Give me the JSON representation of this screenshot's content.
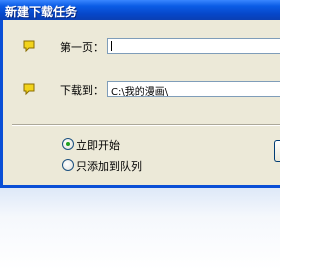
{
  "window": {
    "title": "新建下载任务"
  },
  "form": {
    "page": {
      "label": "第一页：",
      "value": ""
    },
    "save_to": {
      "label": "下载到：",
      "value": "C:\\我的漫画\\"
    }
  },
  "options": [
    {
      "label": "立即开始",
      "selected": true
    },
    {
      "label": "只添加到队列",
      "selected": false
    }
  ],
  "colors": {
    "titlebar": "#0b5ce6",
    "dialog_bg": "#ece9d8",
    "field_border": "#7f9db9",
    "note_icon": "#f2d31b"
  }
}
